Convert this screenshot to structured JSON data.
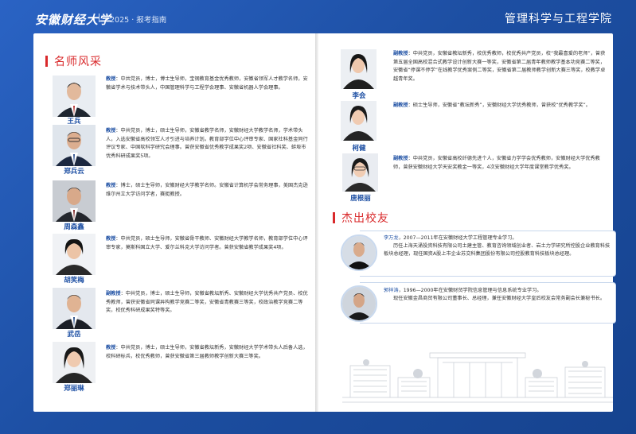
{
  "header": {
    "logo": "安徽财经大学",
    "guide": "2025 · 报考指南",
    "school": "管理科学与工程学院"
  },
  "sections": {
    "teachers_title": "名师风采",
    "alumni_title": "杰出校友"
  },
  "teachers_left": [
    {
      "name": "王兵",
      "title": "教授",
      "bio": "：中共党员，博士，博士生导师，宝钢教育基金优秀教师，安徽省领军人才教学名师，安徽省学术与技术带头人，中国管理科学与工程学会理事、安徽省机器人学会理事。"
    },
    {
      "name": "郑兵云",
      "title": "教授",
      "bio": "：中共党员，博士，硕士生导师，安徽省教学名师，安徽财经大学教学名师，学术带头人，入选安徽省高校领军人才引进与培养计划。教育部学位中心评审专家、国家社科基金同行评议专家、中国软科学研究会理事。曾获安徽省优秀教学成果奖2项、安徽省社科奖、蚌埠市优秀科研成果奖5项。"
    },
    {
      "name": "周森鑫",
      "title": "教授",
      "bio": "：博士，硕士生导师，安徽财经大学教学名师。安徽省计算机学会常务理事，美国杰克逊维尔州立大学访问学者，赛艇教授。"
    },
    {
      "name": "胡笑梅",
      "title": "教授",
      "bio": "：中共党员，硕士生导师，安徽省骨干教师、安徽财经大学教学名师，教育部学位中心评审专家，莫斯科国立大学、爱尔兰科克大学访问学者。曾获安徽省教学成果奖4项。"
    },
    {
      "name": "武岳",
      "title": "副教授",
      "bio": "：中共党员，博士，硕士生导师，安徽省教坛新秀、安徽财经大学优秀共产党员、校优秀教师，曾获安徽省同课异构教学竞赛二等奖，安徽省青教赛三等奖，校政治教学竞赛二等奖，校优秀科研成果奖特等奖。"
    },
    {
      "name": "郑丽琳",
      "title": "教授",
      "bio": "：中共党员，博士，硕士生导师，安徽省教坛新秀，安徽财经大学学术带头人后备人选，校科研标兵，校优秀教师，曾获安徽省第三届教师教学创新大赛三等奖。"
    }
  ],
  "teachers_right": [
    {
      "name": "李会",
      "title": "副教授",
      "bio": "：中共党员，安徽省教坛新秀，校优秀教师，校优秀共产党员，校“我最喜爱的老师”，曾获第五届全国高校混合式教学设计创新大赛一等奖，安徽省第二届青年教师教学基本功竞赛二等奖，安徽省“停课不停学”在线教学优秀案例二等奖，安徽省第二届教师教学创新大赛三等奖，校教学卓越青年奖。"
    },
    {
      "name": "柯健",
      "title": "副教授",
      "bio": "：硕士生导师，安徽省“教坛新秀”，安徽财经大学优秀教师，曾获校“优秀教学奖”。"
    },
    {
      "name": "唐根丽",
      "title": "副教授",
      "bio": "：中共党员，安徽省高校纤德先进个人，安徽省力学学会优秀教师，安徽财经大学优秀教师，曾获安徽财经大学天安奖教金一等奖，4次安徽财经大学年度课堂教学优秀奖。"
    }
  ],
  "alumni": [
    {
      "name": "李万龙",
      "line1": "，2007—2011年在安徽财经大学工程管理专业学习。",
      "rest": "历任上海天涌投资科技有限公司土建主管、教育咨询领域创业者、岩土力学研究所控股企业教育科技板块总经理，现任国资A股上市企业苏交科集团股份有限公司控股教育科技板块总经理。"
    },
    {
      "name": "郭祥涛",
      "line1": "，1996—2000年在安徽财贸学院信息管理与信息系统专业学习。",
      "rest": "现任安徽金昌商贸有限公司董事长、总经理，兼任安徽财经大学皇后校友会常务副会长兼秘书长。"
    }
  ]
}
